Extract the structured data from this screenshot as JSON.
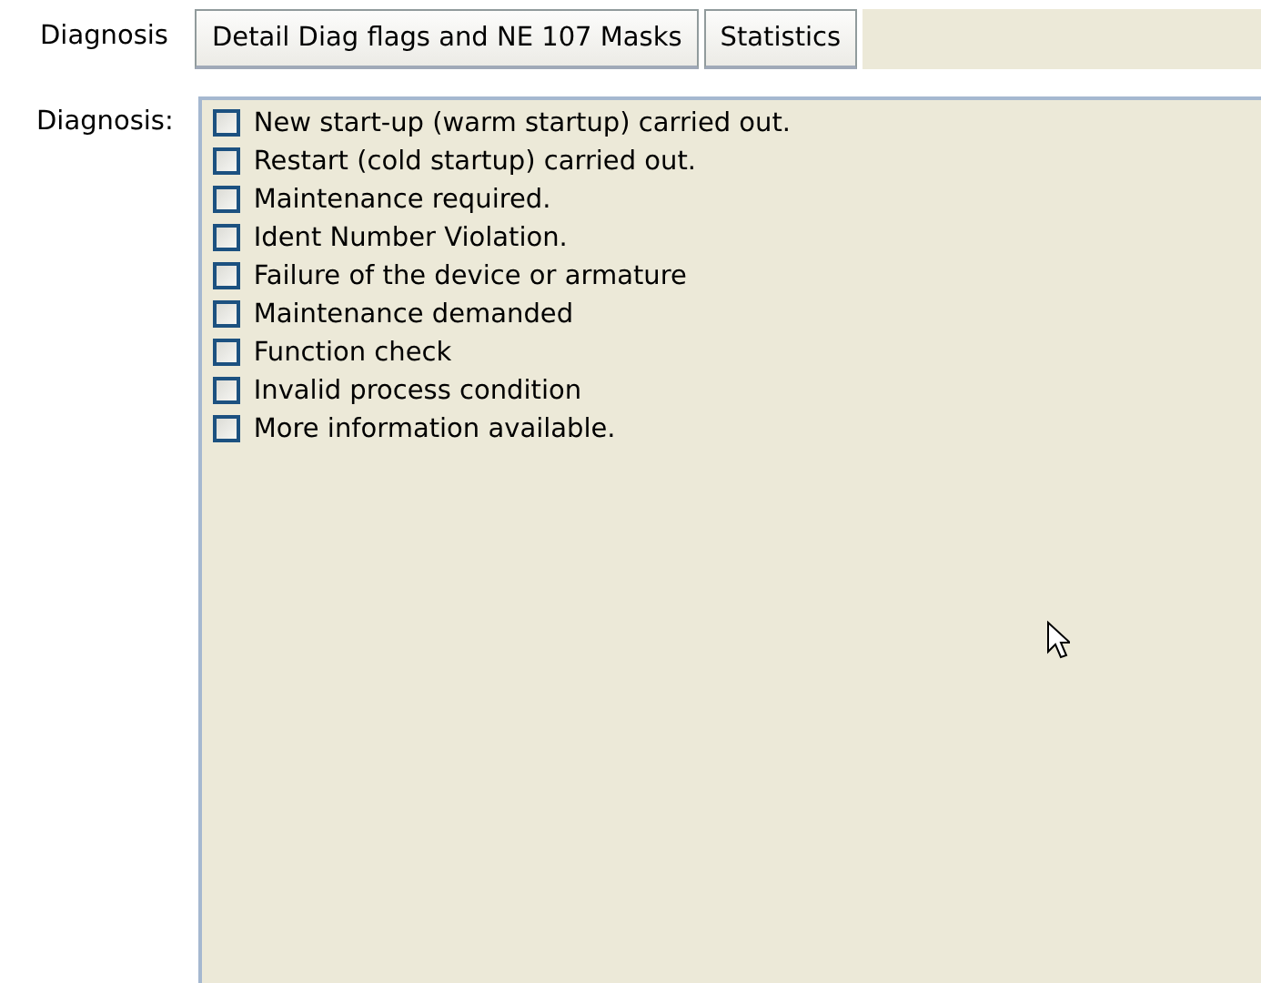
{
  "tabs": [
    {
      "label": "Diagnosis",
      "selected": true
    },
    {
      "label": "Detail Diag flags and NE 107 Masks",
      "selected": false
    },
    {
      "label": "Statistics",
      "selected": false
    }
  ],
  "diagnosis": {
    "label": "Diagnosis:",
    "items": [
      {
        "label": "New start-up (warm startup) carried out.",
        "checked": false
      },
      {
        "label": "Restart (cold startup) carried out.",
        "checked": false
      },
      {
        "label": "Maintenance required.",
        "checked": false
      },
      {
        "label": "Ident Number Violation.",
        "checked": false
      },
      {
        "label": "Failure of the device or armature",
        "checked": false
      },
      {
        "label": "Maintenance demanded",
        "checked": false
      },
      {
        "label": "Function check",
        "checked": false
      },
      {
        "label": "Invalid process condition",
        "checked": false
      },
      {
        "label": "More information available.",
        "checked": false
      }
    ]
  }
}
